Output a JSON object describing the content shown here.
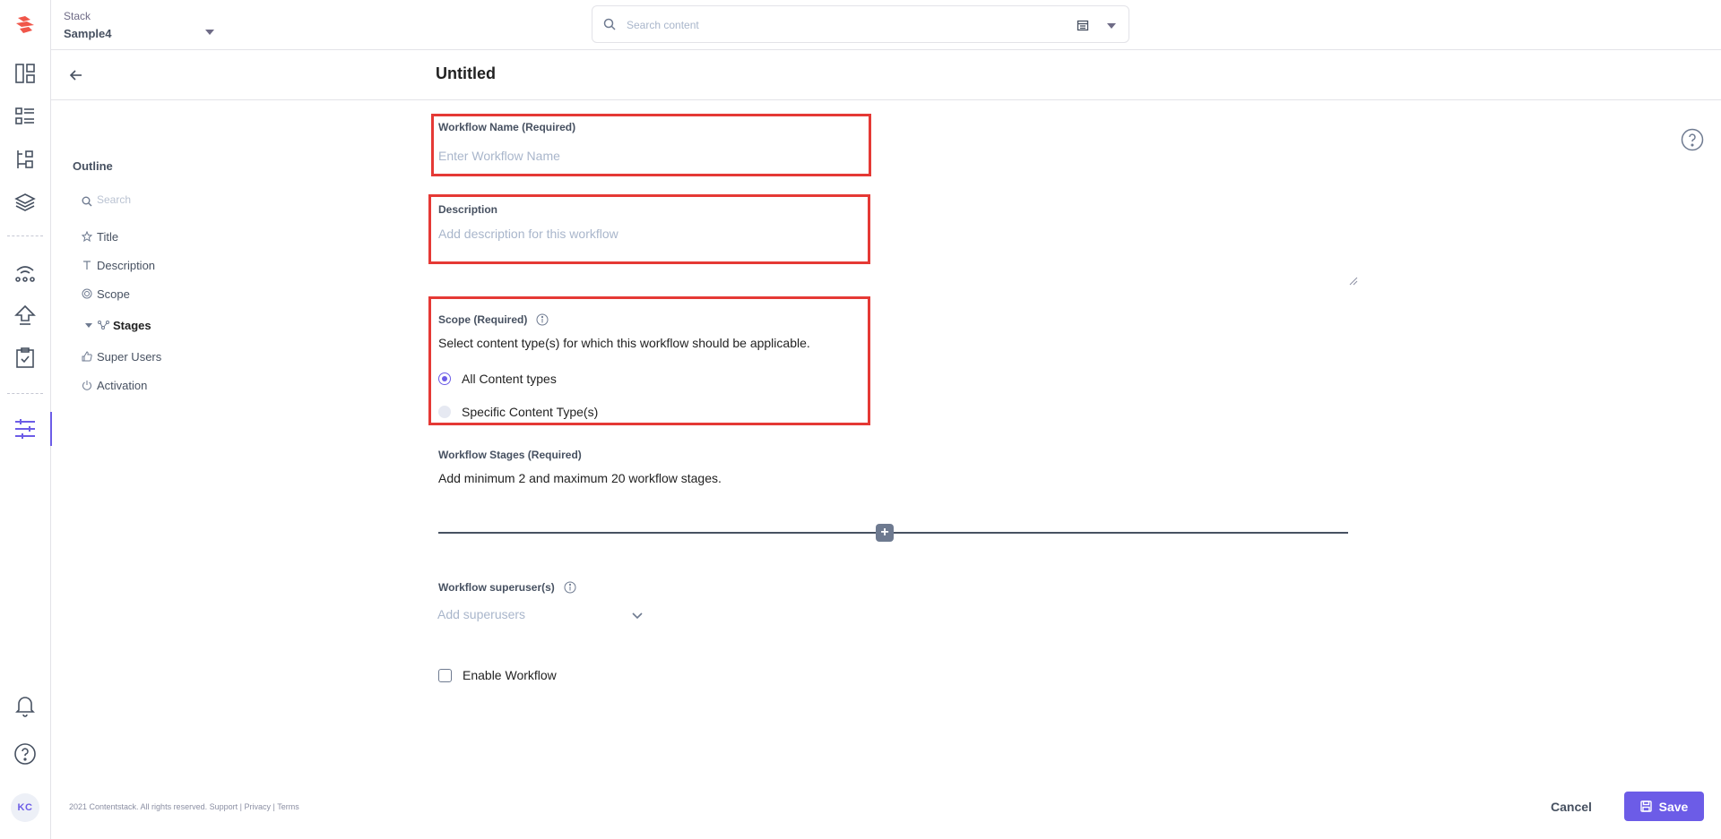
{
  "topbar": {
    "stack_label": "Stack",
    "stack_name": "Sample4",
    "search_placeholder": "Search content"
  },
  "page": {
    "title": "Untitled"
  },
  "outline": {
    "title": "Outline",
    "search_placeholder": "Search",
    "items": [
      {
        "label": "Title",
        "icon": "star-icon"
      },
      {
        "label": "Description",
        "icon": "text-icon"
      },
      {
        "label": "Scope",
        "icon": "scope-icon"
      },
      {
        "label": "Stages",
        "icon": "stages-icon"
      },
      {
        "label": "Super Users",
        "icon": "thumb-icon"
      },
      {
        "label": "Activation",
        "icon": "power-icon"
      }
    ]
  },
  "form": {
    "workflow_name": {
      "label": "Workflow Name (Required)",
      "placeholder": "Enter Workflow Name"
    },
    "description": {
      "label": "Description",
      "placeholder": "Add description for this workflow"
    },
    "scope": {
      "label": "Scope (Required)",
      "help": "Select content type(s) for which this workflow should be applicable.",
      "options": [
        {
          "label": "All Content types",
          "selected": true
        },
        {
          "label": "Specific Content Type(s)",
          "selected": false
        }
      ]
    },
    "stages": {
      "label": "Workflow Stages (Required)",
      "help": "Add minimum 2 and maximum 20 workflow stages.",
      "add_symbol": "+"
    },
    "superusers": {
      "label": "Workflow superuser(s)",
      "placeholder": "Add superusers"
    },
    "enable": {
      "label": "Enable Workflow",
      "checked": false
    }
  },
  "footer": {
    "copyright": "2021 Contentstack. All rights reserved.",
    "support": "Support",
    "sep1": "|",
    "privacy": "Privacy",
    "sep2": "|",
    "terms": "Terms"
  },
  "actions": {
    "cancel": "Cancel",
    "save": "Save"
  },
  "user": {
    "initials": "KC"
  },
  "colors": {
    "accent": "#6c5ce7",
    "highlight": "#e53935",
    "text_muted": "#475161"
  }
}
